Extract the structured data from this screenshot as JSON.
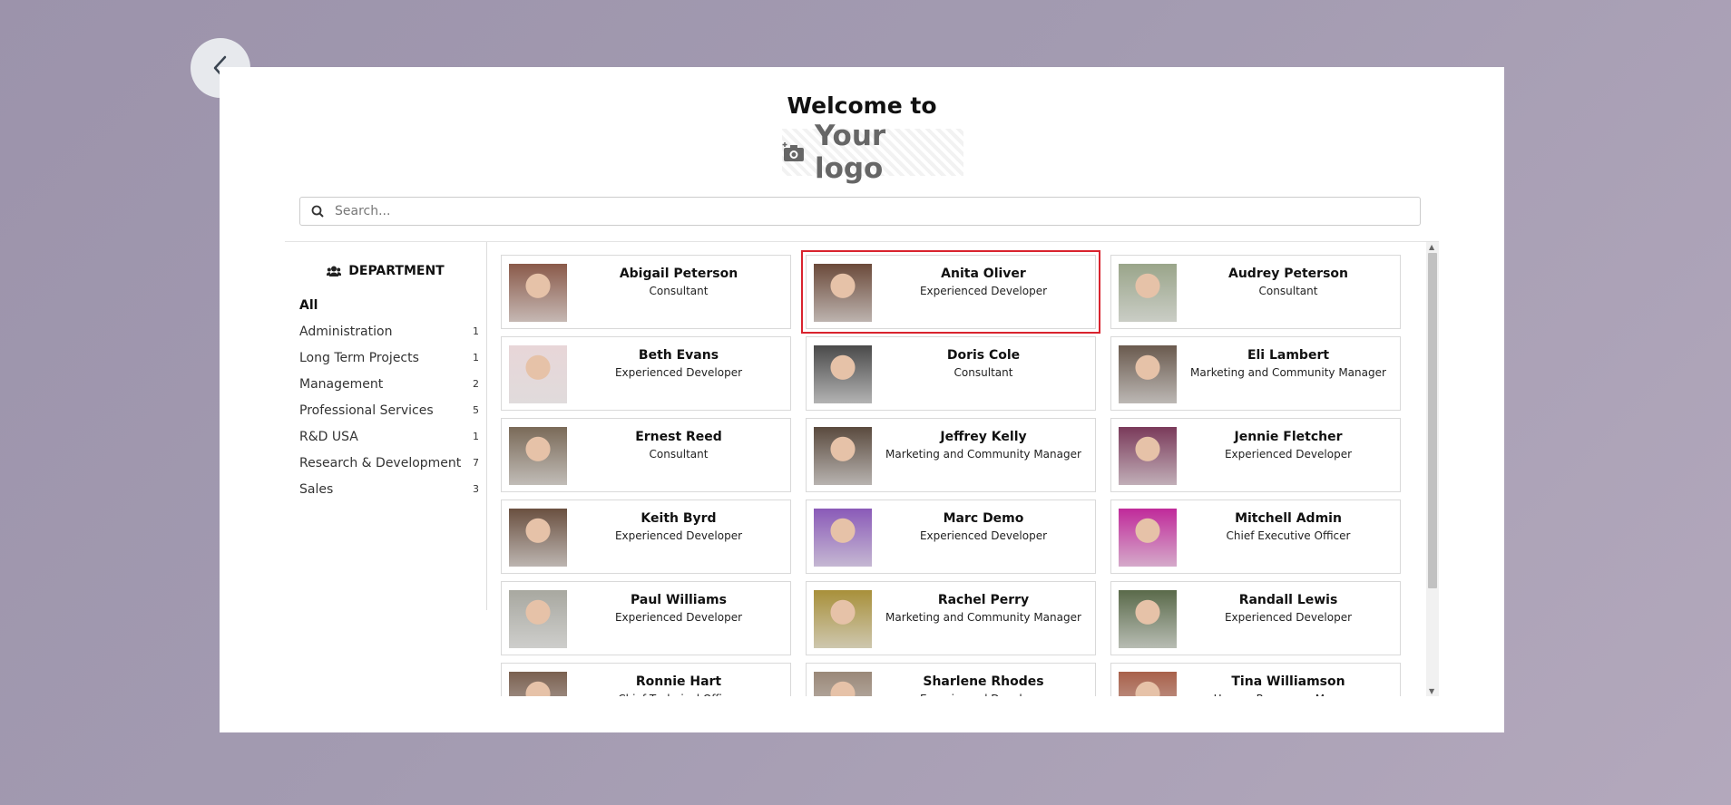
{
  "back_button": {
    "icon": "chevron-left-icon"
  },
  "header": {
    "welcome": "Welcome to",
    "logo_text": "Your logo",
    "logo_icon": "camera-plus-icon"
  },
  "search": {
    "placeholder": "Search...",
    "value": ""
  },
  "sidebar": {
    "title": "DEPARTMENT",
    "title_icon": "users-icon",
    "items": [
      {
        "label": "All",
        "count": "",
        "active": true
      },
      {
        "label": "Administration",
        "count": "1"
      },
      {
        "label": "Long Term Projects",
        "count": "1"
      },
      {
        "label": "Management",
        "count": "2"
      },
      {
        "label": "Professional Services",
        "count": "5"
      },
      {
        "label": "R&D USA",
        "count": "1"
      },
      {
        "label": "Research & Development",
        "count": "7"
      },
      {
        "label": "Sales",
        "count": "3"
      }
    ]
  },
  "employees": [
    {
      "name": "Abigail Peterson",
      "role": "Consultant",
      "color": "#8a5a4a"
    },
    {
      "name": "Anita Oliver",
      "role": "Experienced Developer",
      "color": "#6b4a3a",
      "selected": true
    },
    {
      "name": "Audrey Peterson",
      "role": "Consultant",
      "color": "#9aa58a"
    },
    {
      "name": "Beth Evans",
      "role": "Experienced Developer",
      "color": "#e8d6d8"
    },
    {
      "name": "Doris Cole",
      "role": "Consultant",
      "color": "#4a4a4a"
    },
    {
      "name": "Eli Lambert",
      "role": "Marketing and Community Manager",
      "color": "#6a5a4e"
    },
    {
      "name": "Ernest Reed",
      "role": "Consultant",
      "color": "#7a6a58"
    },
    {
      "name": "Jeffrey Kelly",
      "role": "Marketing and Community Manager",
      "color": "#5a4a3e"
    },
    {
      "name": "Jennie Fletcher",
      "role": "Experienced Developer",
      "color": "#7a3a5a"
    },
    {
      "name": "Keith Byrd",
      "role": "Experienced Developer",
      "color": "#6a5040"
    },
    {
      "name": "Marc Demo",
      "role": "Experienced Developer",
      "color": "#8a5ab8"
    },
    {
      "name": "Mitchell Admin",
      "role": "Chief Executive Officer",
      "color": "#c02a9a"
    },
    {
      "name": "Paul Williams",
      "role": "Experienced Developer",
      "color": "#a8a8a0"
    },
    {
      "name": "Rachel Perry",
      "role": "Marketing and Community Manager",
      "color": "#a8903a"
    },
    {
      "name": "Randall Lewis",
      "role": "Experienced Developer",
      "color": "#5a6a4a"
    },
    {
      "name": "Ronnie Hart",
      "role": "Chief Technical Officer",
      "color": "#7a6050"
    },
    {
      "name": "Sharlene Rhodes",
      "role": "Experienced Developer",
      "color": "#9a8878"
    },
    {
      "name": "Tina Williamson",
      "role": "Human Resources Manager",
      "color": "#a8604a"
    }
  ]
}
